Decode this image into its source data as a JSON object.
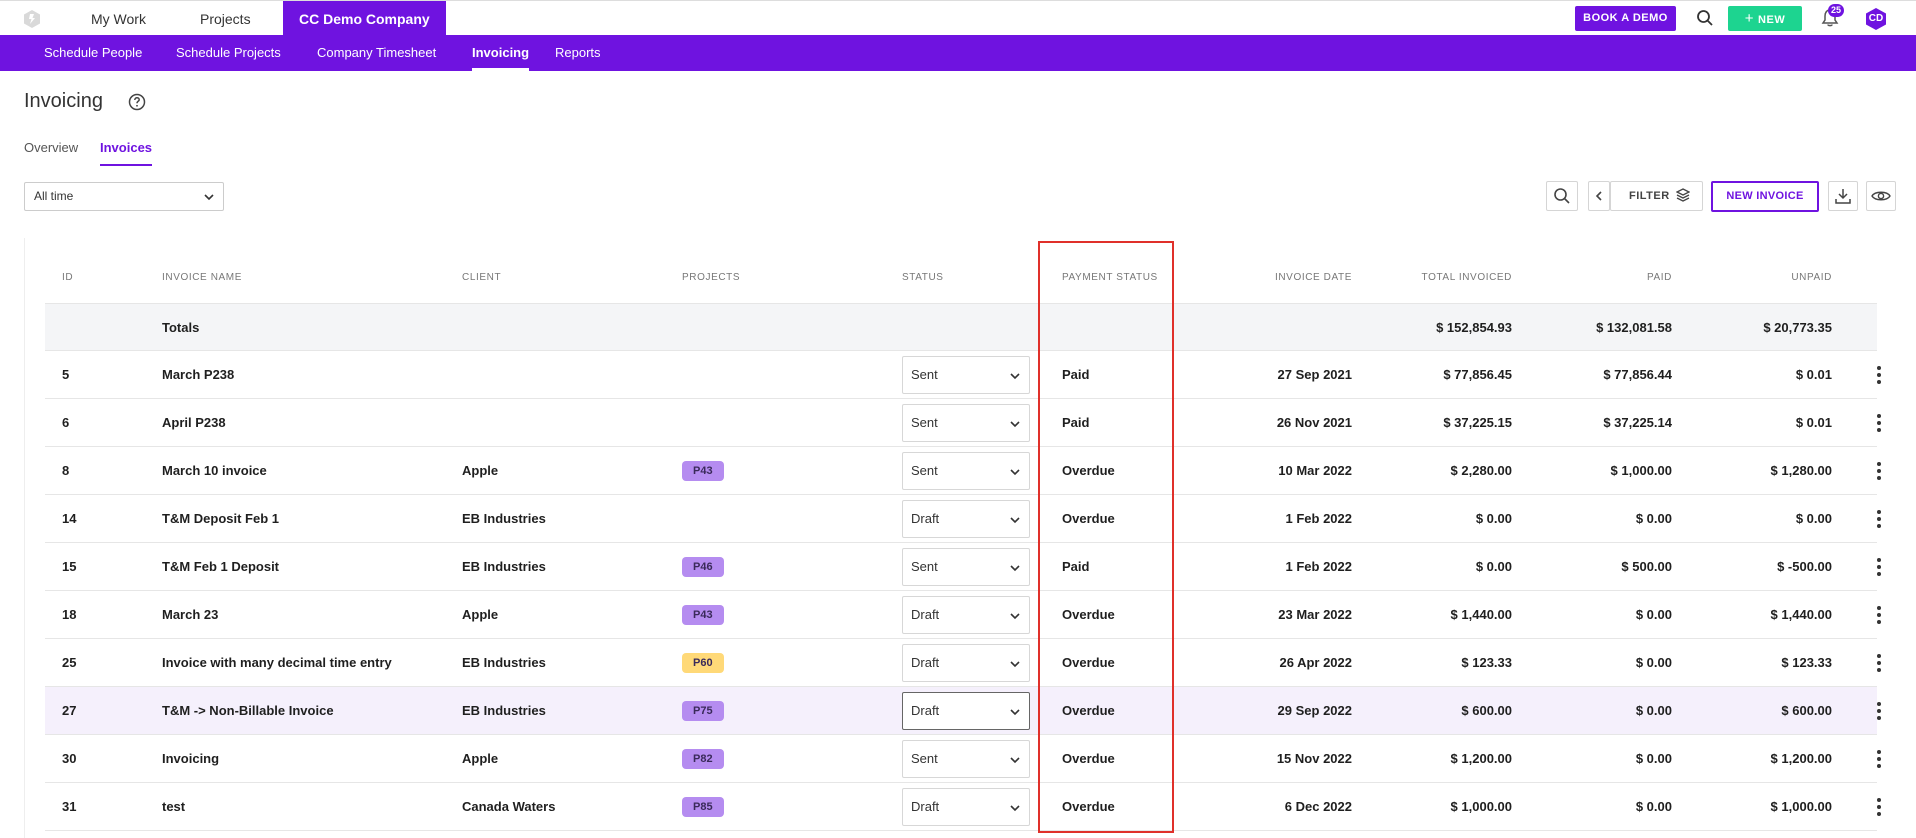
{
  "topnav": {
    "my_work": "My Work",
    "projects": "Projects",
    "company": "CC Demo Company"
  },
  "actions": {
    "book_demo": "BOOK A DEMO",
    "new": "NEW",
    "notifications": "25",
    "avatar": "CD"
  },
  "subnav": [
    "Schedule People",
    "Schedule Projects",
    "Company Timesheet",
    "Invoicing",
    "Reports"
  ],
  "page": {
    "title": "Invoicing",
    "tabs": [
      "Overview",
      "Invoices"
    ]
  },
  "toolbar": {
    "period": "All time",
    "filter": "FILTER",
    "new_invoice": "NEW INVOICE"
  },
  "columns": [
    "ID",
    "INVOICE NAME",
    "CLIENT",
    "PROJECTS",
    "STATUS",
    "PAYMENT STATUS",
    "INVOICE DATE",
    "TOTAL INVOICED",
    "PAID",
    "UNPAID"
  ],
  "totals": {
    "label": "Totals",
    "total_invoiced": "$ 152,854.93",
    "paid": "$ 132,081.58",
    "unpaid": "$ 20,773.35"
  },
  "rows": [
    {
      "id": "5",
      "name": "March P238",
      "client": "",
      "project": "",
      "status": "Sent",
      "payment": "Paid",
      "date": "27 Sep 2021",
      "total": "$ 77,856.45",
      "paid": "$ 77,856.44",
      "unpaid": "$ 0.01"
    },
    {
      "id": "6",
      "name": "April P238",
      "client": "",
      "project": "",
      "status": "Sent",
      "payment": "Paid",
      "date": "26 Nov 2021",
      "total": "$ 37,225.15",
      "paid": "$ 37,225.14",
      "unpaid": "$ 0.01"
    },
    {
      "id": "8",
      "name": "March 10 invoice",
      "client": "Apple",
      "project": "P43",
      "status": "Sent",
      "payment": "Overdue",
      "date": "10 Mar 2022",
      "total": "$ 2,280.00",
      "paid": "$ 1,000.00",
      "unpaid": "$ 1,280.00"
    },
    {
      "id": "14",
      "name": "T&M Deposit Feb 1",
      "client": "EB Industries",
      "project": "",
      "status": "Draft",
      "payment": "Overdue",
      "date": "1 Feb 2022",
      "total": "$ 0.00",
      "paid": "$ 0.00",
      "unpaid": "$ 0.00"
    },
    {
      "id": "15",
      "name": "T&M Feb 1 Deposit",
      "client": "EB Industries",
      "project": "P46",
      "status": "Sent",
      "payment": "Paid",
      "date": "1 Feb 2022",
      "total": "$ 0.00",
      "paid": "$ 500.00",
      "unpaid": "$ -500.00"
    },
    {
      "id": "18",
      "name": "March 23",
      "client": "Apple",
      "project": "P43",
      "status": "Draft",
      "payment": "Overdue",
      "date": "23 Mar 2022",
      "total": "$ 1,440.00",
      "paid": "$ 0.00",
      "unpaid": "$ 1,440.00"
    },
    {
      "id": "25",
      "name": "Invoice with many decimal time entry",
      "client": "EB Industries",
      "project": "P60",
      "status": "Draft",
      "payment": "Overdue",
      "date": "26 Apr 2022",
      "total": "$ 123.33",
      "paid": "$ 0.00",
      "unpaid": "$ 123.33"
    },
    {
      "id": "27",
      "name": "T&M -> Non-Billable Invoice",
      "client": "EB Industries",
      "project": "P75",
      "status": "Draft",
      "payment": "Overdue",
      "date": "29 Sep 2022",
      "total": "$ 600.00",
      "paid": "$ 0.00",
      "unpaid": "$ 600.00"
    },
    {
      "id": "30",
      "name": "Invoicing",
      "client": "Apple",
      "project": "P82",
      "status": "Sent",
      "payment": "Overdue",
      "date": "15 Nov 2022",
      "total": "$ 1,200.00",
      "paid": "$ 0.00",
      "unpaid": "$ 1,200.00"
    },
    {
      "id": "31",
      "name": "test",
      "client": "Canada Waters",
      "project": "P85",
      "status": "Draft",
      "payment": "Overdue",
      "date": "6 Dec 2022",
      "total": "$ 1,000.00",
      "paid": "$ 0.00",
      "unpaid": "$ 1,000.00"
    }
  ],
  "colors": {
    "brand": "#6f13e0",
    "new_button": "#1dd490",
    "pill_purple": "#b58cf0",
    "pill_yellow": "#ffd978",
    "highlight": "#e0302a"
  }
}
